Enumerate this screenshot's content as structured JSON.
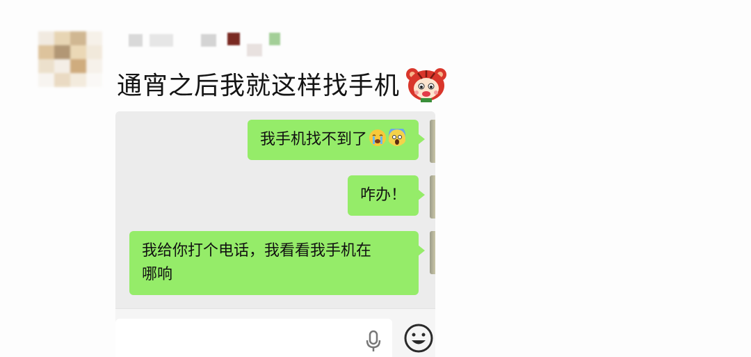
{
  "post": {
    "text": "通宵之后我就这样找手机",
    "sticker_icon": "tiger-face-icon"
  },
  "chat": {
    "messages": [
      {
        "text": "我手机找不到了",
        "emojis": [
          "crying-face-icon",
          "screaming-face-icon"
        ]
      },
      {
        "text": "咋办！"
      },
      {
        "text_line1": "我给你打个电话，我看看我手机在",
        "text_line2": "哪响"
      }
    ],
    "input_bar": {
      "voice_icon": "microphone-icon",
      "emoji_icon": "smiley-face-icon"
    }
  },
  "colors": {
    "bubble": "#95ec69",
    "chat_bg": "#ececec"
  }
}
